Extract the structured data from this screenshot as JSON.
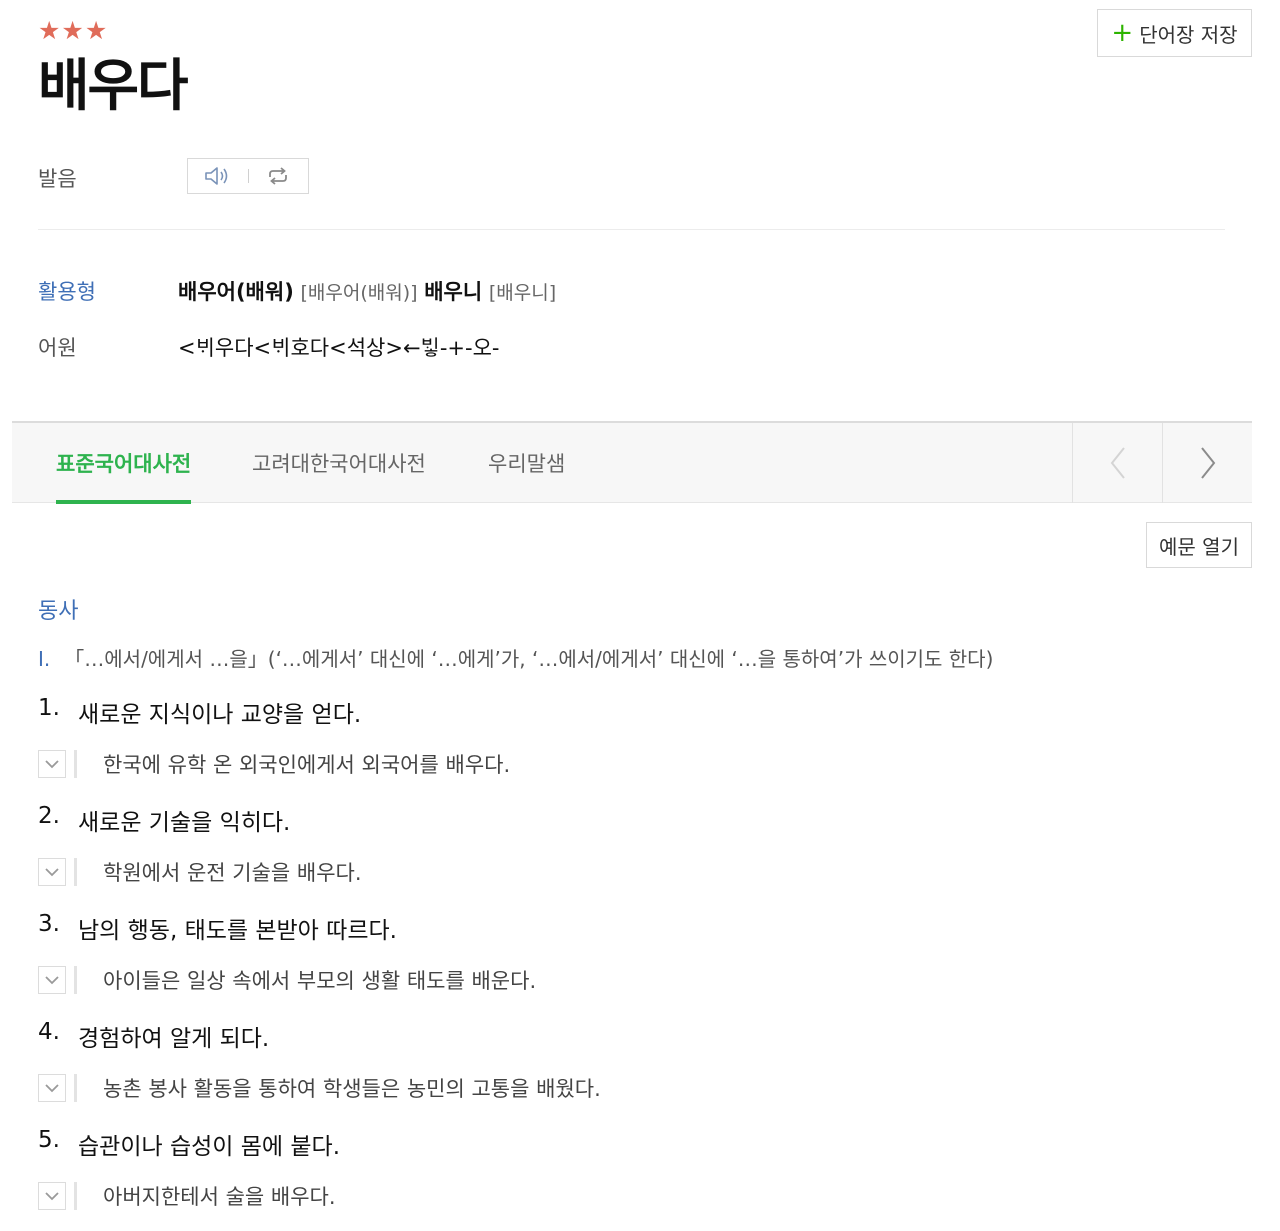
{
  "entry": {
    "stars": "★★★",
    "headword": "배우다",
    "save_button": "단어장 저장"
  },
  "pronunciation": {
    "label": "발음"
  },
  "conjugation": {
    "label": "활용형",
    "form1": "배우어(배워)",
    "form1_pron": "[배우어(배워)]",
    "form2": "배우니",
    "form2_pron": "[배우니]"
  },
  "etymology": {
    "label": "어원",
    "value": "<ᄇᆡ우다<ᄇᆡ호다<석상>←ᄇᆡᇂ-+-오-"
  },
  "tabs": [
    {
      "label": "표준국어대사전",
      "active": true
    },
    {
      "label": "고려대한국어대사전",
      "active": false
    },
    {
      "label": "우리말샘",
      "active": false
    }
  ],
  "example_toggle": "예문 열기",
  "part_of_speech": "동사",
  "pattern": {
    "roman": "I.",
    "text": "「…에서/에게서 …을」(‘…에게서’ 대신에 ‘…에게’가, ‘…에서/에게서’ 대신에 ‘…을 통하여’가 쓰이기도 한다)"
  },
  "senses": [
    {
      "num": "1.",
      "definition": "새로운 지식이나 교양을 얻다.",
      "example": "한국에 유학 온 외국인에게서 외국어를 배우다."
    },
    {
      "num": "2.",
      "definition": "새로운 기술을 익히다.",
      "example": "학원에서 운전 기술을 배우다."
    },
    {
      "num": "3.",
      "definition": "남의 행동, 태도를 본받아 따르다.",
      "example": "아이들은 일상 속에서 부모의 생활 태도를 배운다."
    },
    {
      "num": "4.",
      "definition": "경험하여 알게 되다.",
      "example": "농촌 봉사 활동을 통하여 학생들은 농민의 고통을 배웠다."
    },
    {
      "num": "5.",
      "definition": "습관이나 습성이 몸에 붙다.",
      "example": "아버지한테서 술을 배우다."
    }
  ],
  "icons": {
    "speaker": "speaker-icon",
    "repeat": "repeat-icon",
    "prev": "chevron-left-icon",
    "next": "chevron-right-icon",
    "expand": "chevron-down-icon",
    "add": "plus-icon"
  },
  "colors": {
    "star": "#e06c5a",
    "accent_green": "#2eb34e",
    "label_blue": "#3f6fb6"
  }
}
